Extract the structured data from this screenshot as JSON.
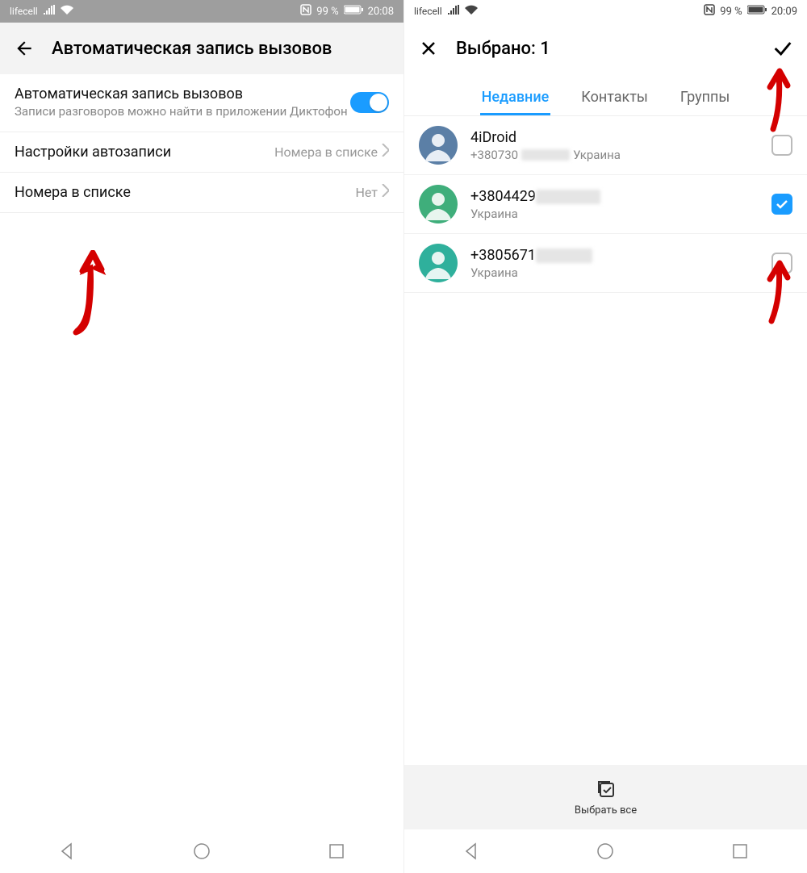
{
  "left": {
    "status": {
      "carrier": "lifecell",
      "battery_pct": "99 %",
      "time": "20:08"
    },
    "header": {
      "title": "Автоматическая запись вызовов"
    },
    "rows": {
      "auto_record": {
        "title": "Автоматическая запись вызовов",
        "sub": "Записи разговоров можно найти в приложении Диктофон",
        "toggle_on": true
      },
      "settings": {
        "title": "Настройки автозаписи",
        "value": "Номера в списке"
      },
      "numbers": {
        "title": "Номера в списке",
        "value": "Нет"
      }
    }
  },
  "right": {
    "status": {
      "carrier": "lifecell",
      "battery_pct": "99 %",
      "time": "20:09"
    },
    "header": {
      "title": "Выбрано: 1"
    },
    "tabs": {
      "recent": "Недавние",
      "contacts": "Контакты",
      "groups": "Группы"
    },
    "contacts": [
      {
        "name": "4iDroid",
        "number_prefix": "+380730",
        "country": "Украина",
        "checked": false,
        "avatar_color": "#5b7fa6"
      },
      {
        "name": "+3804429",
        "number_prefix": "",
        "country": "Украина",
        "checked": true,
        "avatar_color": "#3fae7b"
      },
      {
        "name": "+3805671",
        "number_prefix": "",
        "country": "Украина",
        "checked": false,
        "avatar_color": "#2fb09c"
      }
    ],
    "action": {
      "select_all": "Выбрать все"
    }
  }
}
